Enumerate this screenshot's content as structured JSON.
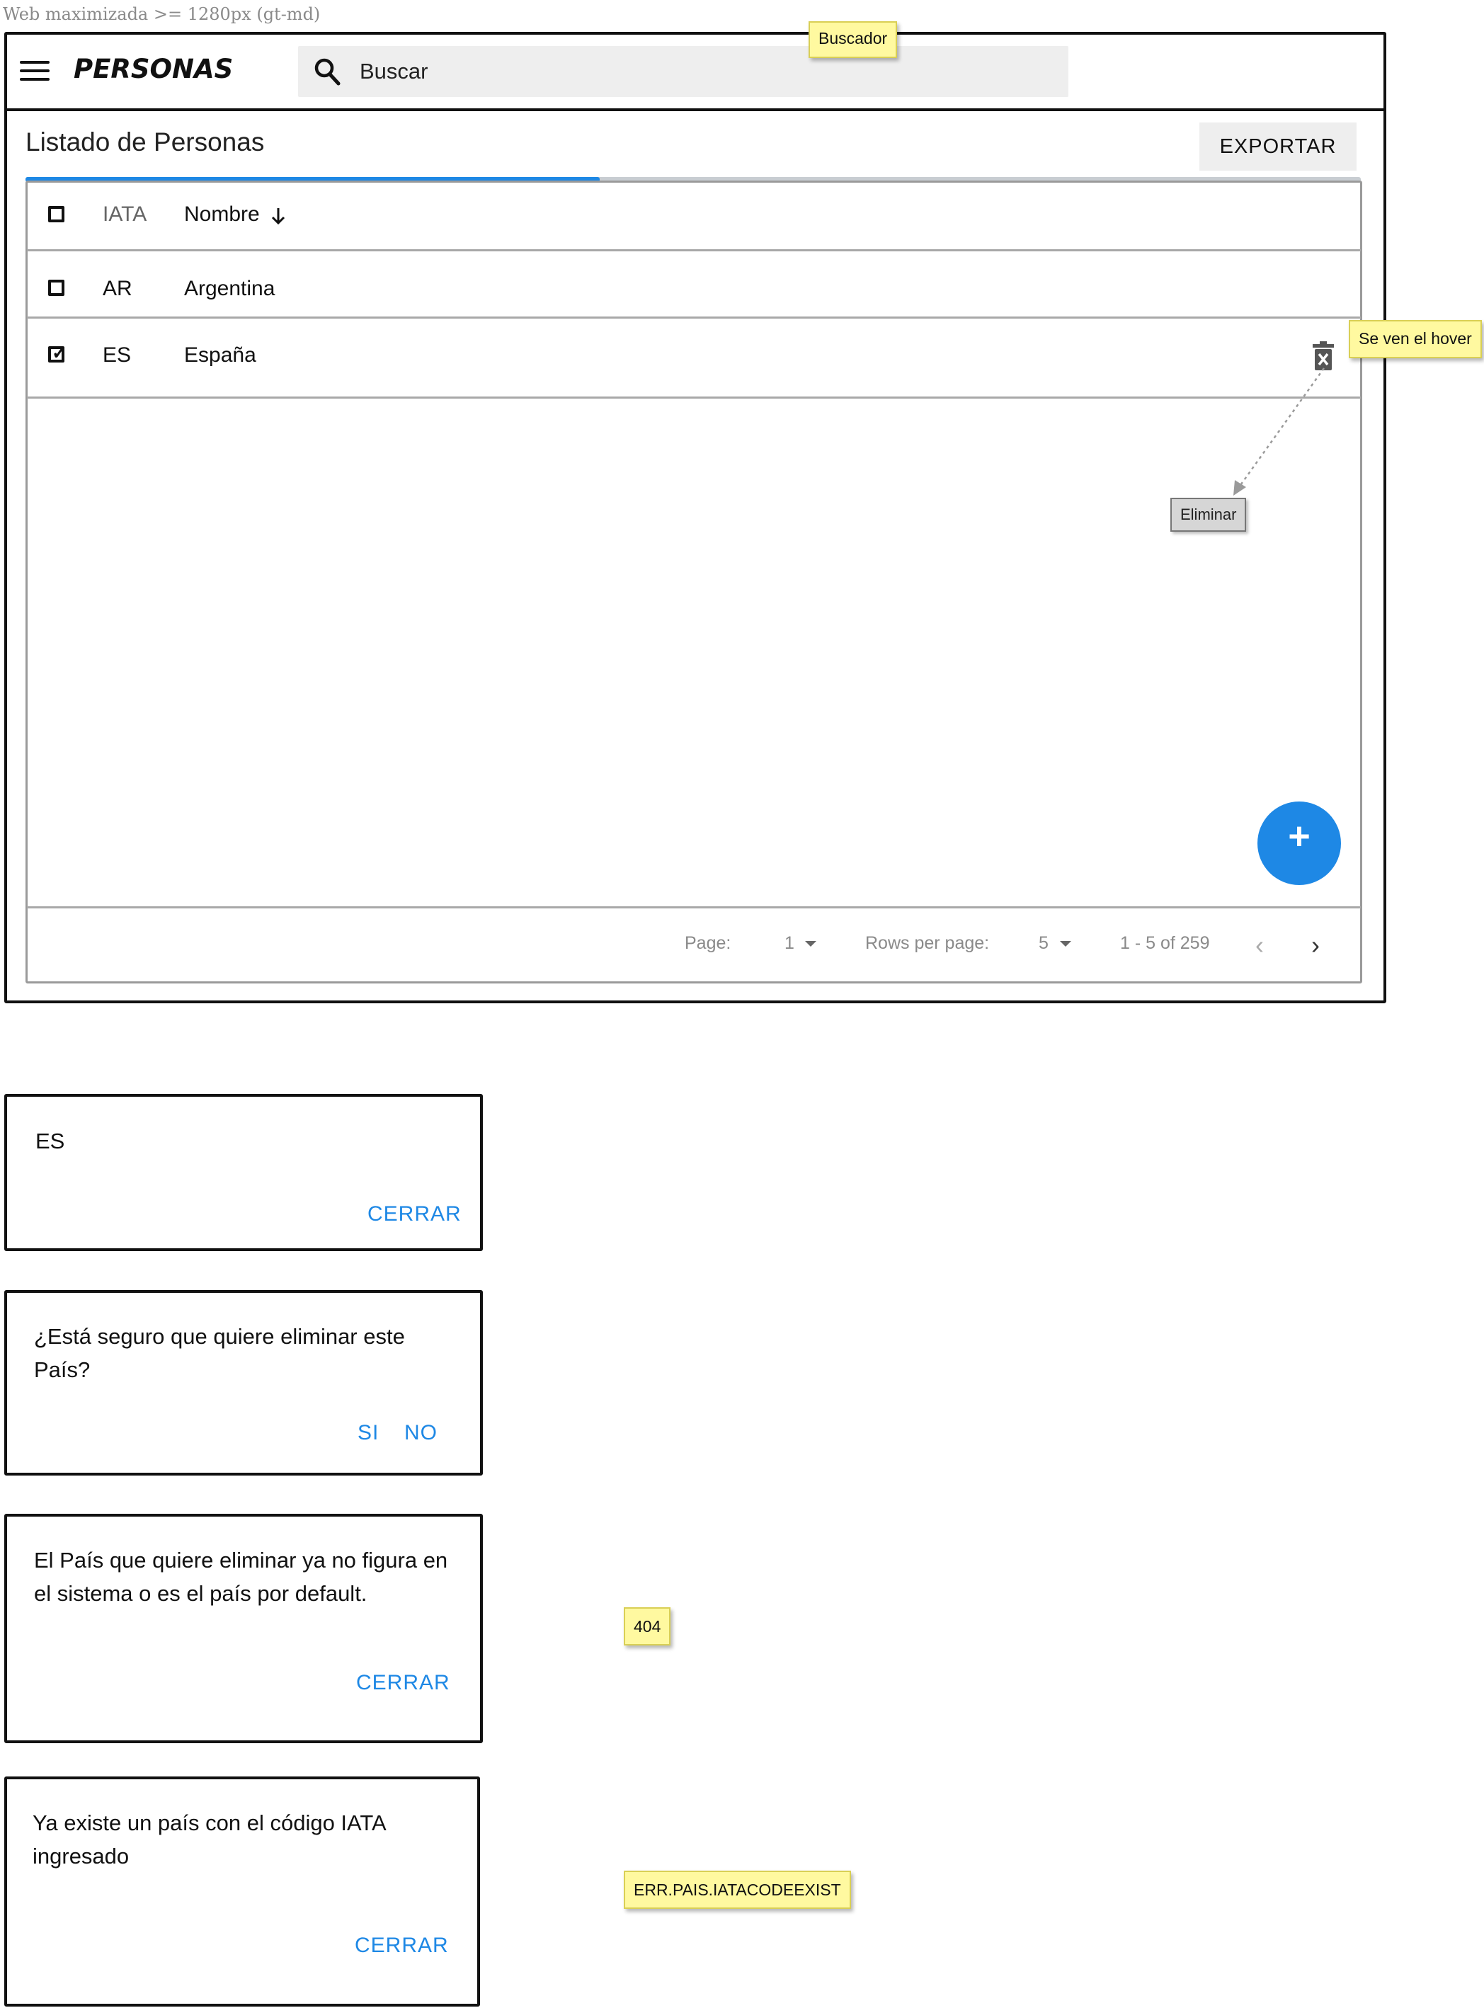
{
  "caption": "Web maximizada >= 1280px (gt-md)",
  "notes": {
    "buscador": "Buscador",
    "hover": "Se ven el hover",
    "code_404": "404",
    "code_iata": "ERR.PAIS.IATACODEEXIST"
  },
  "toolbar": {
    "title": "PERSONAS",
    "search_placeholder": "Buscar"
  },
  "list": {
    "title": "Listado de Personas",
    "export_label": "EXPORTAR",
    "progress_percent": 43
  },
  "table": {
    "columns": [
      "IATA",
      "Nombre"
    ],
    "sort_icon": "arrow-down-icon",
    "rows": [
      {
        "iata": "AR",
        "name": "Argentina",
        "checked": false
      },
      {
        "iata": "ES",
        "name": "España",
        "checked": true
      }
    ],
    "delete_tooltip": "Eliminar"
  },
  "pagination": {
    "page_label": "Page:",
    "page_value": "1",
    "rows_label": "Rows per page:",
    "rows_value": "5",
    "range": "1 - 5 of 259"
  },
  "dialogs": [
    {
      "text": "ES",
      "buttons": [
        "CERRAR"
      ]
    },
    {
      "text": "¿Está seguro que quiere eliminar este País?",
      "buttons": [
        "SI",
        "NO"
      ]
    },
    {
      "text": "El País que quiere eliminar ya no figura en el sistema o es el país por default.",
      "buttons": [
        "CERRAR"
      ]
    },
    {
      "text": "Ya existe un país con el código IATA ingresado",
      "buttons": [
        "CERRAR"
      ]
    }
  ],
  "colors": {
    "accent": "#1e88e5",
    "note": "#fff9a0"
  }
}
